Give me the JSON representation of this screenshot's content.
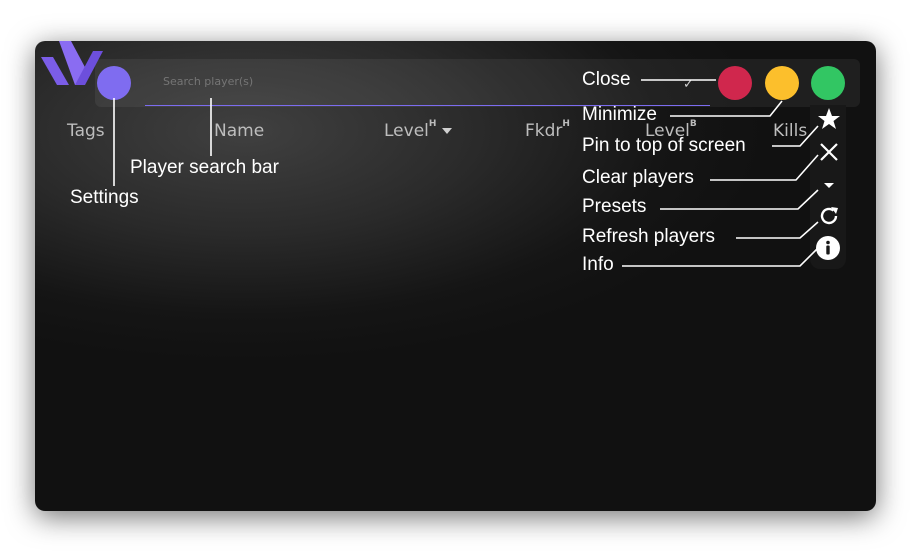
{
  "app": {
    "brand_color": "#7f6cf0"
  },
  "search": {
    "placeholder": "Search player(s)"
  },
  "columns": [
    {
      "label": "Tags"
    },
    {
      "label": "Name"
    },
    {
      "label": "Level",
      "mark": "H"
    },
    {
      "label": "Fkdr",
      "mark": "H"
    },
    {
      "label": "Level",
      "mark": "B"
    },
    {
      "label": "Kills"
    }
  ],
  "window_controls": [
    {
      "name": "close",
      "color": "#d0274d"
    },
    {
      "name": "minimize",
      "color": "#fcbf2c"
    },
    {
      "name": "maximize",
      "color": "#32c663"
    }
  ],
  "toolbar_icons": [
    "star-icon",
    "close-icon",
    "chevron-down-icon",
    "refresh-icon",
    "info-icon"
  ],
  "annotations": {
    "close": "Close",
    "minimize": "Minimize",
    "pin": "Pin to top of screen",
    "clear": "Clear players",
    "presets": "Presets",
    "refresh": "Refresh players",
    "info": "Info",
    "search_bar": "Player search bar",
    "settings": "Settings"
  }
}
